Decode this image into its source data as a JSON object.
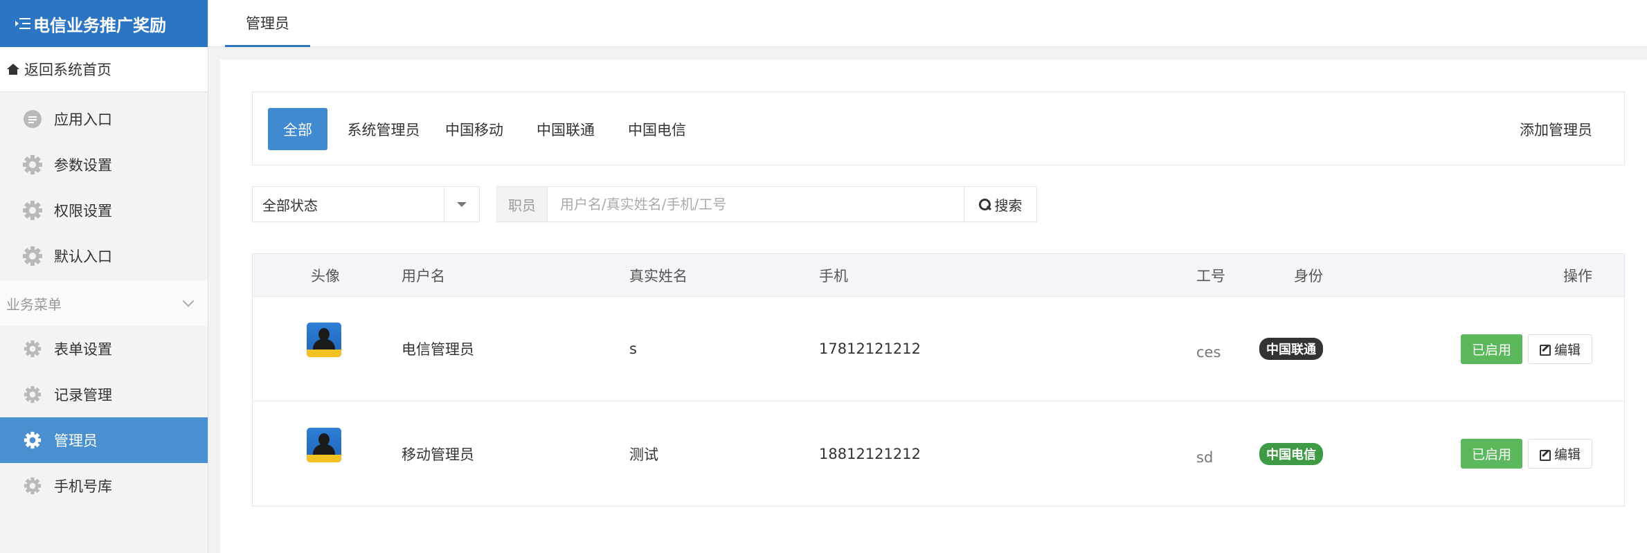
{
  "app": {
    "title": "电信业务推广奖励"
  },
  "sidebar": {
    "home_link": "返回系统首页",
    "items": [
      {
        "label": "应用入口",
        "icon": "chat-bubble-icon"
      },
      {
        "label": "参数设置",
        "icon": "gear-icon"
      },
      {
        "label": "权限设置",
        "icon": "gear-icon"
      },
      {
        "label": "默认入口",
        "icon": "gear-icon"
      }
    ],
    "section_title": "业务菜单",
    "section_items": [
      {
        "label": "表单设置",
        "icon": "gear-icon"
      },
      {
        "label": "记录管理",
        "icon": "gear-icon"
      },
      {
        "label": "管理员",
        "icon": "gear-icon",
        "active": true
      },
      {
        "label": "手机号库",
        "icon": "gear-icon"
      }
    ]
  },
  "topbar": {
    "tab": "管理员"
  },
  "filter": {
    "tabs": [
      "全部",
      "系统管理员",
      "中国移动",
      "中国联通",
      "中国电信"
    ],
    "active_tab": "全部",
    "add_button": "添加管理员"
  },
  "search": {
    "status_value": "全部状态",
    "addon": "职员",
    "placeholder": "用户名/真实姓名/手机/工号",
    "button": "搜索"
  },
  "table": {
    "headers": {
      "avatar": "头像",
      "username": "用户名",
      "realname": "真实姓名",
      "phone": "手机",
      "role": "身份",
      "empno": "工号",
      "ops": "操作"
    },
    "rows": [
      {
        "username": "电信管理员",
        "realname": "s",
        "phone": "17812121212",
        "role": "中国联通",
        "empno": "ces",
        "status": "已启用",
        "edit": "编辑"
      },
      {
        "username": "移动管理员",
        "realname": "测试",
        "phone": "18812121212",
        "role": "中国电信",
        "empno": "sd",
        "status": "已启用",
        "edit": "编辑"
      }
    ]
  },
  "colors": {
    "brand": "#2c75c2",
    "active_nav": "#4a8fcf",
    "success": "#5cb85c",
    "badge_dark": "#333333",
    "badge_green": "#3f9a45"
  }
}
